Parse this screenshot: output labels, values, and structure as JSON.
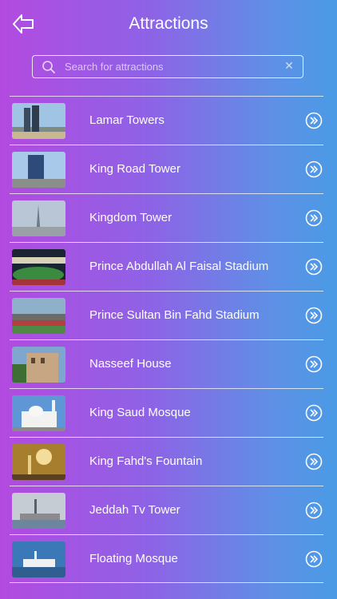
{
  "header": {
    "title": "Attractions"
  },
  "search": {
    "placeholder": "Search for attractions"
  },
  "attractions": [
    {
      "name": "Lamar Towers"
    },
    {
      "name": "King Road Tower"
    },
    {
      "name": "Kingdom Tower"
    },
    {
      "name": "Prince Abdullah Al Faisal Stadium"
    },
    {
      "name": "Prince Sultan Bin Fahd Stadium"
    },
    {
      "name": "Nasseef House"
    },
    {
      "name": "King Saud Mosque"
    },
    {
      "name": "King Fahd's Fountain"
    },
    {
      "name": "Jeddah Tv Tower"
    },
    {
      "name": "Floating Mosque"
    }
  ],
  "icons": {
    "back": "arrow-left-icon",
    "search": "search-icon",
    "clear": "close-icon",
    "row_action": "chevron-right-circle-icon"
  }
}
